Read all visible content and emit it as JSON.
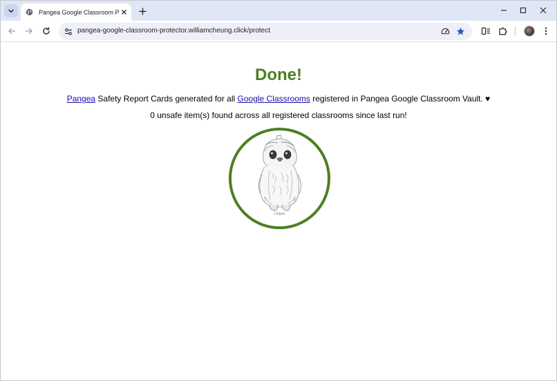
{
  "browser": {
    "tab": {
      "title": "Pangea Google Classroom Prot"
    },
    "address_bar": {
      "url": "pangea-google-classroom-protector.williamcheung.click/protect"
    }
  },
  "page": {
    "heading": "Done!",
    "summary": {
      "pangea_link": "Pangea",
      "text_a": " Safety Report Cards generated for all ",
      "classrooms_link": "Google Classrooms",
      "text_b": " registered in Pangea Google Classroom Vault. ♥"
    },
    "result": "0 unsafe item(s) found across all registered classrooms since last run!",
    "image_caption": "Lingua"
  },
  "colors": {
    "heading": "#4c7f21",
    "badge_border": "#4c7f21",
    "link": "#1a0dab",
    "tabstrip": "#dfe6f6",
    "omnibox": "#edf0f8",
    "bookmark_star": "#2a56c6"
  },
  "icons": {
    "tab_search": "chevron-down-icon",
    "favicon": "globe-icon",
    "tab_close": "close-icon",
    "new_tab": "plus-icon",
    "minimize": "minimize-icon",
    "maximize": "maximize-icon",
    "close_window": "close-icon",
    "back": "arrow-left-icon",
    "forward": "arrow-right-icon",
    "reload": "reload-icon",
    "site_info": "tune-icon",
    "performance": "gauge-icon",
    "bookmark": "star-icon",
    "reading_mode": "reading-mode-icon",
    "extensions": "puzzle-icon",
    "menu": "more-vert-icon"
  }
}
